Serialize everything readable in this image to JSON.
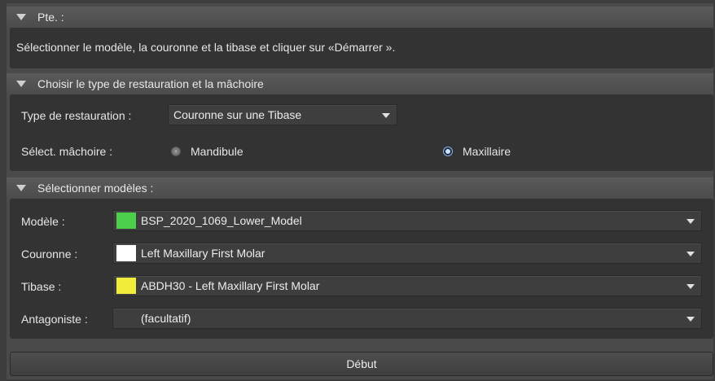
{
  "sections": {
    "pte": {
      "title": "Pte. :",
      "message": "Sélectionner le modèle, la couronne et la tibase et cliquer sur «Démarrer »."
    },
    "restoration": {
      "title": "Choisir le type de restauration et la mâchoire",
      "type_label": "Type de restauration :",
      "type_value": "Couronne sur une Tibase",
      "jaw_label": "Sélect. mâchoire :",
      "jaw_options": [
        {
          "label": "Mandibule",
          "selected": false
        },
        {
          "label": "Maxillaire",
          "selected": true
        }
      ]
    },
    "models": {
      "title": "Sélectionner modèles :",
      "rows": [
        {
          "label": "Modèle :",
          "value": "BSP_2020_1069_Lower_Model",
          "swatch": "#4cd04c"
        },
        {
          "label": "Couronne :",
          "value": "Left Maxillary First Molar",
          "swatch": "#ffffff"
        },
        {
          "label": "Tibase :",
          "value": "ABDH30 - Left Maxillary First Molar",
          "swatch": "#f2ec3a"
        },
        {
          "label": "Antagoniste :",
          "value": "(facultatif)",
          "swatch": null
        }
      ]
    }
  },
  "start_button": "Début"
}
